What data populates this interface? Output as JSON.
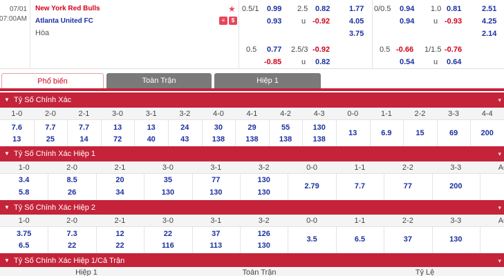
{
  "match": {
    "date": "07/01",
    "time": "07:00AM",
    "home": "New York Red Bulls",
    "away": "Atlanta United FC",
    "draw": "Hòa",
    "left_odds": {
      "r1": {
        "hcap": "0.5/1",
        "h": "0.99",
        "ou": "2.5",
        "o": "0.82",
        "x": "1.77"
      },
      "r2": {
        "a": "0.93",
        "u": "u",
        "uv": "-0.92",
        "x": "4.05"
      },
      "r3": {
        "x": "3.75"
      },
      "r4": {
        "hcap": "0.5",
        "h": "0.77",
        "ou": "2.5/3",
        "o": "-0.92"
      },
      "r5": {
        "a": "-0.85",
        "u": "u",
        "uv": "0.82"
      }
    },
    "right_odds": {
      "r1": {
        "hcap": "0/0.5",
        "h": "0.94",
        "ou": "1.0",
        "o": "0.81",
        "x": "2.51"
      },
      "r2": {
        "a": "0.94",
        "u": "u",
        "uv": "-0.93",
        "x": "4.25"
      },
      "r3": {
        "x": "2.14"
      },
      "r4": {
        "hcap": "0.5",
        "h": "-0.66",
        "ou": "1/1.5",
        "o": "-0.76"
      },
      "r5": {
        "a": "0.54",
        "u": "u",
        "uv": "0.64"
      }
    }
  },
  "tabs": [
    "Phổ biến",
    "Toàn Trận",
    "Hiệp 1"
  ],
  "sections": {
    "s1": {
      "title": "Tỷ Số Chính Xác",
      "headers": [
        "1-0",
        "2-0",
        "2-1",
        "3-0",
        "3-1",
        "3-2",
        "4-0",
        "4-1",
        "4-2",
        "4-3",
        "0-0",
        "1-1",
        "2-2",
        "3-3",
        "4-4"
      ],
      "row1": [
        "7.6",
        "7.7",
        "7.7",
        "13",
        "13",
        "24",
        "30",
        "29",
        "55",
        "130"
      ],
      "row2": [
        "13",
        "25",
        "14",
        "72",
        "40",
        "43",
        "138",
        "138",
        "138",
        "138"
      ],
      "mid": [
        "13",
        "6.9",
        "15",
        "69",
        "200"
      ]
    },
    "s2": {
      "title": "Tỷ Số Chính Xác Hiệp 1",
      "headers": [
        "1-0",
        "2-0",
        "2-1",
        "3-0",
        "3-1",
        "3-2",
        "0-0",
        "1-1",
        "2-2",
        "3-3",
        "AO"
      ],
      "row1": [
        "3.4",
        "8.5",
        "20",
        "35",
        "77",
        "130"
      ],
      "row2": [
        "5.8",
        "26",
        "34",
        "130",
        "130",
        "130"
      ],
      "mid": [
        "2.79",
        "7.7",
        "77",
        "200"
      ]
    },
    "s3": {
      "title": "Tỷ Số Chính Xác Hiệp 2",
      "headers": [
        "1-0",
        "2-0",
        "2-1",
        "3-0",
        "3-1",
        "3-2",
        "0-0",
        "1-1",
        "2-2",
        "3-3",
        "AO"
      ],
      "row1": [
        "3.75",
        "7.3",
        "12",
        "22",
        "37",
        "126"
      ],
      "row2": [
        "6.5",
        "22",
        "22",
        "116",
        "113",
        "130"
      ],
      "mid": [
        "3.5",
        "6.5",
        "37",
        "130"
      ]
    },
    "s4": {
      "title": "Tỷ Số Chính Xác Hiệp 1/Cả Trận",
      "headers": [
        "Hiệp 1",
        "Toàn Trận",
        "Tỷ Lệ"
      ]
    }
  },
  "colors": {
    "accent": "#c4233a",
    "home": "#d0021b",
    "away": "#1b2fa0"
  }
}
